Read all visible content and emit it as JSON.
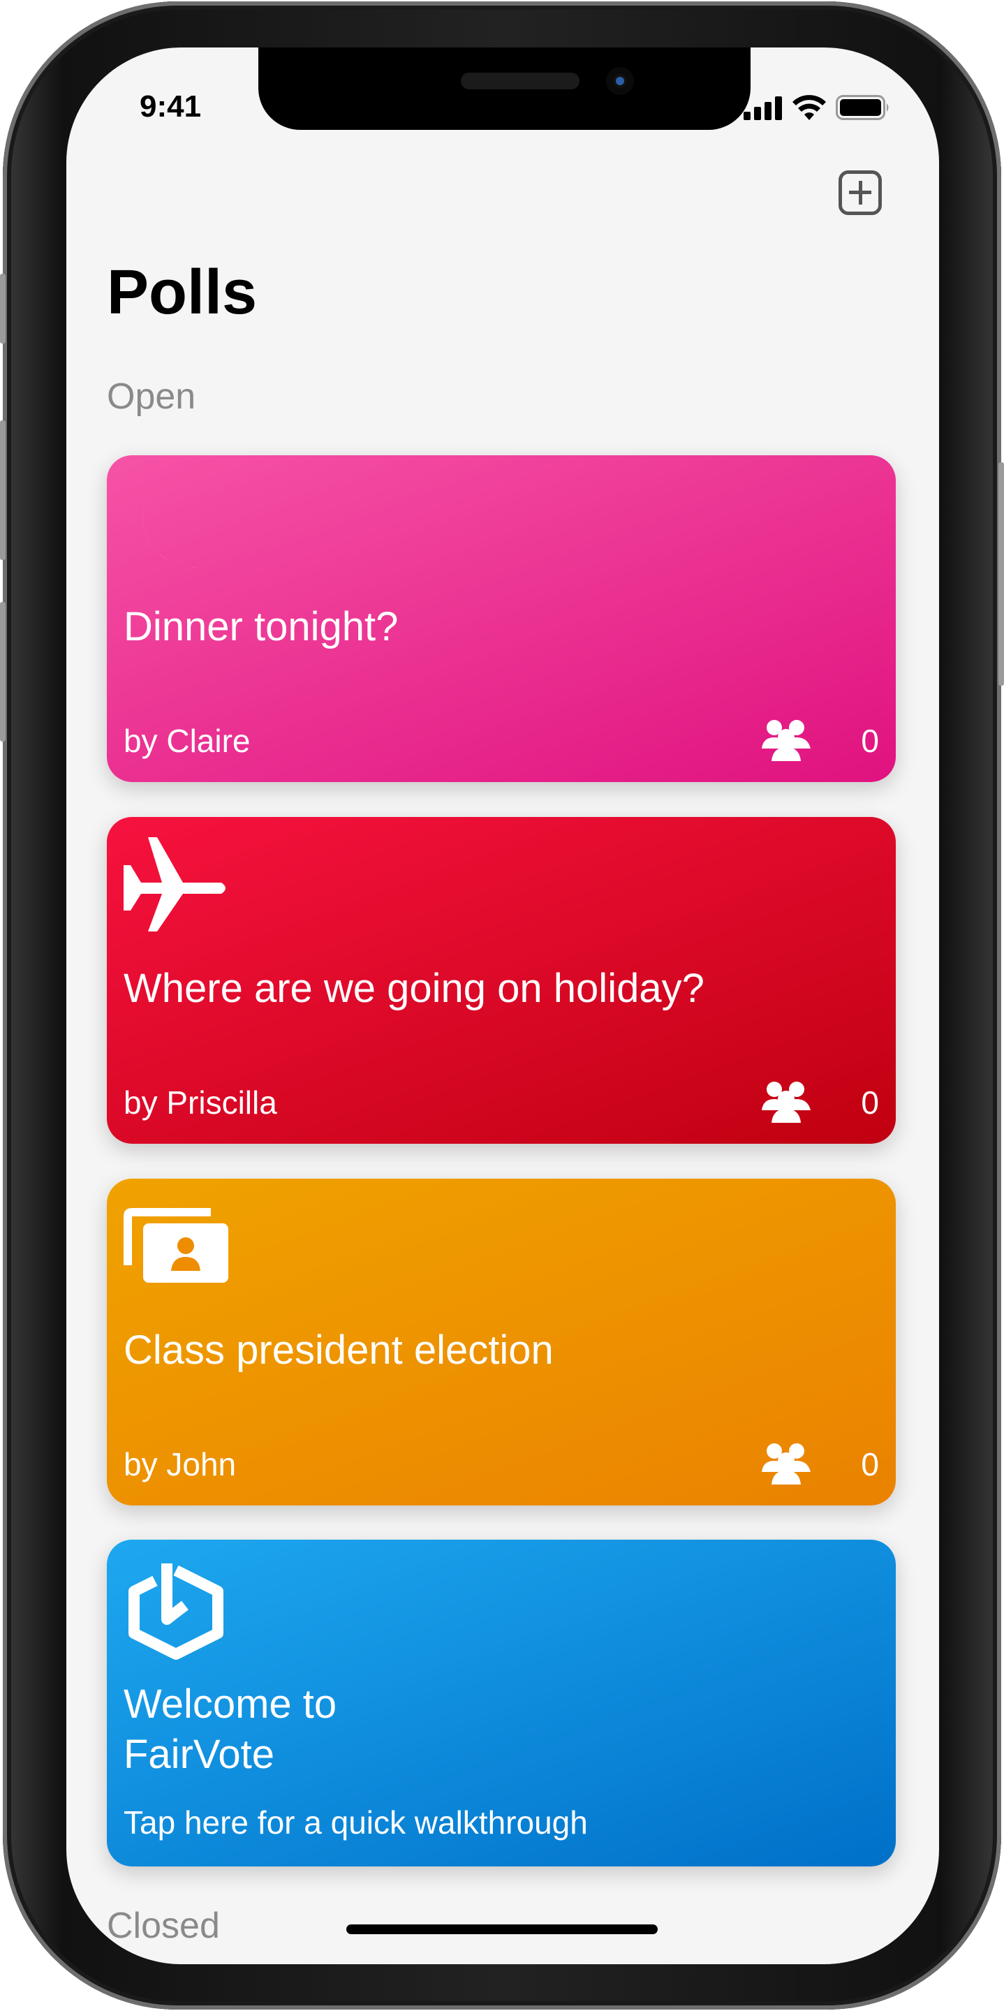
{
  "status_bar": {
    "time": "9:41"
  },
  "header": {
    "title": "Polls",
    "add_icon": "plus-square-icon"
  },
  "sections": {
    "open": "Open",
    "closed": "Closed"
  },
  "polls": [
    {
      "icon": "moon-icon",
      "title": "Dinner tonight?",
      "author": "by Claire",
      "participants": "0",
      "colors": [
        "#f653a6",
        "#e0127f"
      ]
    },
    {
      "icon": "airplane-icon",
      "title": "Where are we going on holiday?",
      "author": "by Priscilla",
      "participants": "0",
      "colors": [
        "#f7123f",
        "#c00010"
      ]
    },
    {
      "icon": "ballot-cards-icon",
      "title": "Class president election",
      "author": "by John",
      "participants": "0",
      "colors": [
        "#f0a200",
        "#ea8200"
      ]
    }
  ],
  "welcome": {
    "icon": "fairvote-logo-icon",
    "title_line1": "Welcome to",
    "title_line2": "FairVote",
    "subtitle": "Tap here for a quick walkthrough",
    "colors": [
      "#1ea8f0",
      "#0070c8"
    ]
  }
}
